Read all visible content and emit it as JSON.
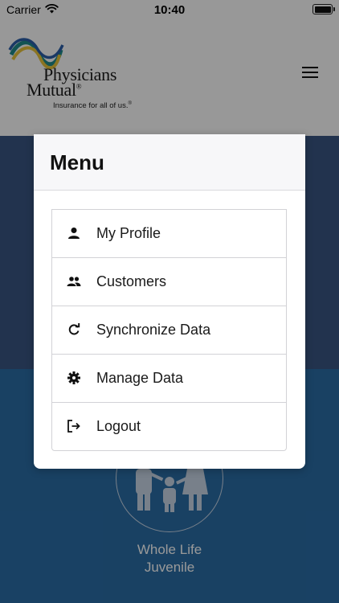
{
  "status_bar": {
    "carrier": "Carrier",
    "time": "10:40"
  },
  "header": {
    "logo_line1": "Physicians",
    "logo_line2": "Mutual",
    "logo_registered": "®",
    "tagline": "Insurance for all of us.",
    "tagline_mark": "®"
  },
  "background": {
    "tile_label_line1": "Whole Life",
    "tile_label_line2": "Juvenile"
  },
  "menu": {
    "title": "Menu",
    "items": [
      {
        "label": "My Profile",
        "icon": "person-icon"
      },
      {
        "label": "Customers",
        "icon": "people-icon"
      },
      {
        "label": "Synchronize Data",
        "icon": "sync-icon"
      },
      {
        "label": "Manage Data",
        "icon": "gear-icon"
      },
      {
        "label": "Logout",
        "icon": "logout-icon"
      }
    ]
  },
  "colors": {
    "band_dark": "#3a5682",
    "band_blue": "#2a6da6",
    "modal_header_bg": "#f7f7f9"
  }
}
